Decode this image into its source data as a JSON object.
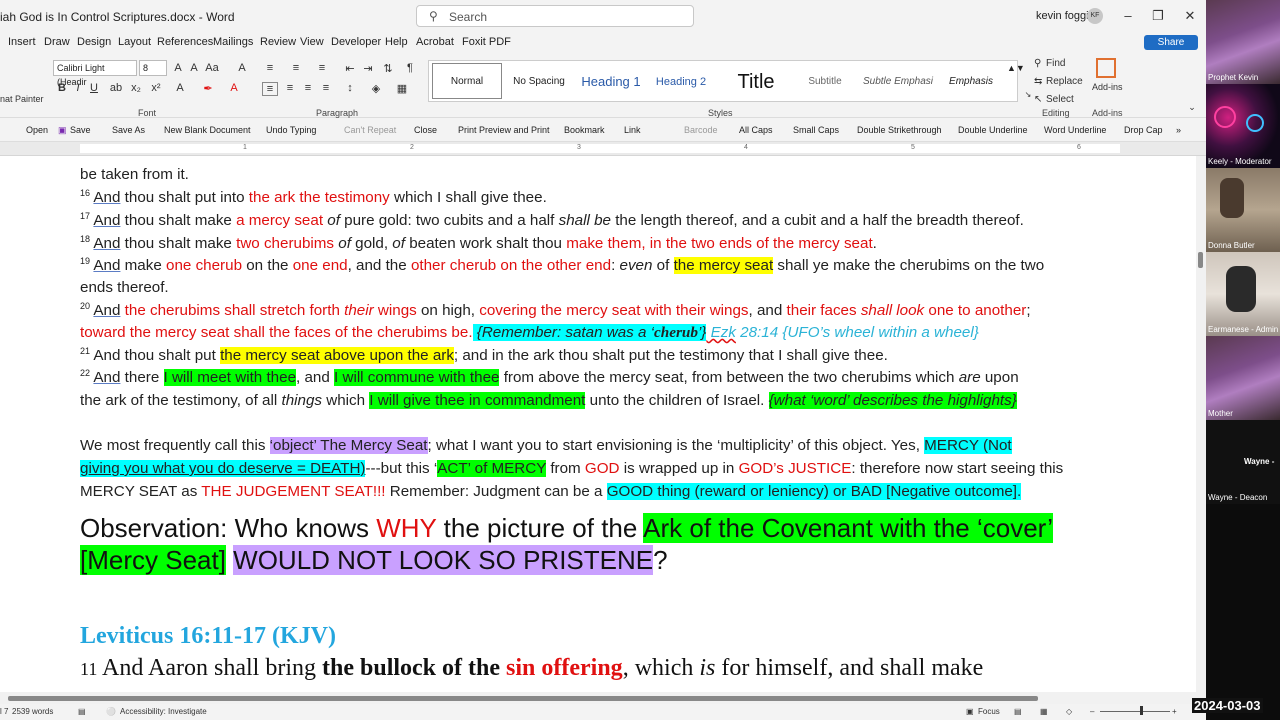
{
  "window": {
    "doc_title": "iah God is In Control Scriptures.docx  -  Word",
    "search_placeholder": "Search",
    "user_name": "kevin foggie",
    "user_initials": "KF",
    "share_label": "Share"
  },
  "menu": [
    "Insert",
    "Draw",
    "Design",
    "Layout",
    "References",
    "Mailings",
    "Review",
    "View",
    "Developer",
    "Help",
    "Acrobat",
    "Foxit PDF"
  ],
  "ribbon": {
    "format_painter": "nat Painter",
    "font_name": "Calibri Light (Headir",
    "font_size": "8",
    "group_font": "Font",
    "group_paragraph": "Paragraph",
    "group_styles": "Styles",
    "group_editing": "Editing",
    "group_addins": "Add-ins",
    "styles": [
      "Normal",
      "No Spacing",
      "Heading 1",
      "Heading 2",
      "Title",
      "Subtitle",
      "Subtle Emphasi",
      "Emphasis"
    ],
    "editing": [
      "Find",
      "Replace",
      "Select"
    ],
    "addins": "Add-ins"
  },
  "qat": [
    "Open",
    "Save",
    "Save As",
    "New Blank Document",
    "Undo Typing",
    "Can't Repeat",
    "Close",
    "Print Preview and Print",
    "Bookmark",
    "Link",
    "Barcode",
    "All Caps",
    "Small Caps",
    "Double Strikethrough",
    "Double Underline",
    "Word Underline",
    "Drop Cap"
  ],
  "ruler_numbers": [
    "1",
    "2",
    "3",
    "4",
    "5",
    "6"
  ],
  "doc": {
    "l0": "be taken from it.",
    "v16_num": "16",
    "v16_and": "And",
    "v16_a": " thou shalt put into ",
    "v16_b": "the ark the testimony",
    "v16_c": " which I shall give thee.",
    "v17_num": "17",
    "v17_and": "And",
    "v17_a": " thou shalt make ",
    "v17_b": "a mercy seat",
    "v17_c": " of",
    "v17_d": " pure gold: two cubits and a half ",
    "v17_e": "shall be",
    "v17_f": " the length thereof, and a cubit and a half the breadth thereof.",
    "v18_num": "18",
    "v18_and": "And",
    "v18_a": " thou shalt make ",
    "v18_b": "two cherubims",
    "v18_c": " of",
    "v18_d": " gold, ",
    "v18_e": "of",
    "v18_f": " beaten work shalt thou ",
    "v18_g": "make them, in the two ends of the mercy seat",
    "v18_h": ".",
    "v19_num": "19",
    "v19_and": "And",
    "v19_a": " make ",
    "v19_b": "one cherub",
    "v19_c": " on the ",
    "v19_d": "one end",
    "v19_e": ", and the ",
    "v19_f": "other cherub on the other end",
    "v19_g": ": ",
    "v19_h": "even",
    "v19_i": " of ",
    "v19_j": "the mercy seat",
    "v19_k": " shall ye make the cherubims on the two",
    "v19_l2": "ends thereof.",
    "v20_num": "20",
    "v20_and": "And",
    "v20_a": " the cherubims shall stretch forth ",
    "v20_b": "their",
    "v20_c": " wings",
    "v20_d": " on high, ",
    "v20_e": "covering the mercy seat with their wings",
    "v20_f": ", and ",
    "v20_g": "their faces ",
    "v20_h": "shall look",
    "v20_i": " one to another",
    "v20_j": ";",
    "v20_l2a": "toward the mercy seat shall the faces of the cherubims be.",
    "v20_l2b": " {Remember: satan was a ‘",
    "v20_l2c": "cherub",
    "v20_l2d": "’}",
    "v20_l2e": "  Ezk",
    "v20_l2f": " 28:14 {UFO’s wheel within a wheel}",
    "v21_num": "21",
    "v21_a": "And thou shalt put ",
    "v21_b": "the mercy seat above upon the ark",
    "v21_c": "; and in the ark thou shalt put the testimony that I shall give thee.",
    "v22_num": "22",
    "v22_and": "And",
    "v22_a": " there ",
    "v22_b": "I will meet with thee",
    "v22_c": ", and ",
    "v22_d": "I will commune with thee",
    "v22_e": " from above the mercy seat, from between the two cherubims which ",
    "v22_f": "are",
    "v22_g": " upon",
    "v22_l2a": "the ark of the testimony, of all ",
    "v22_l2b": "things",
    "v22_l2c": " which ",
    "v22_l2d": "I will give thee in commandment",
    "v22_l2e": " unto the children of Israel. ",
    "v22_l2f": "{what ‘word’ describes the highlights}",
    "p1_a": "We most frequently call this ",
    "p1_b": "‘object’ The Mercy Seat",
    "p1_c": "; what I want you to start envisioning is the ‘multiplicity’ of this object.  Yes, ",
    "p1_d": "MERCY (Not",
    "p2_a": "giving you what you do deserve = DEATH)",
    "p2_b": "---but this ‘",
    "p2_c": "ACT’ of MERCY",
    "p2_d": " from ",
    "p2_e": "GOD",
    "p2_f": " is wrapped up in ",
    "p2_g": "GOD’s JUSTICE",
    "p2_h": ": therefore now start seeing this",
    "p3_a": "MERCY SEAT",
    "p3_b": " as ",
    "p3_c": "THE JUDGEMENT SEAT!!!",
    "p3_d": "  Remember: Judgment can be a ",
    "p3_e": "GOOD",
    "p3_f": " thing (",
    "p3_g": "reward",
    "p3_h": " or ",
    "p3_i": "leniency",
    "p3_j": ") or BAD [",
    "p3_k": "Negative outcome",
    "p3_l": "].",
    "obs_a": "Observation: Who knows ",
    "obs_b": "WHY",
    "obs_c": " the picture of the ",
    "obs_d": "Ark of the Covenant with the ‘cover’",
    "obs2_a": "[Mercy Seat]",
    "obs2_b": " ",
    "obs2_c": "WOULD NOT LOOK SO PRISTENE",
    "obs2_d": "?",
    "lev_heading": "Leviticus 16:11-17 (KJV)",
    "v11_num": "11",
    "v11_a": " And Aaron shall bring ",
    "v11_b": "the bullock of the ",
    "v11_c": "sin offering",
    "v11_d": ", which ",
    "v11_e": "is",
    "v11_f": " for himself, and shall make"
  },
  "status": {
    "page": "l 7",
    "words": "2539 words",
    "accessibility": "Accessibility: Investigate",
    "focus": "Focus"
  },
  "participants": [
    "Prophet Kevin",
    "Keely - Moderator",
    "Donna Butler",
    "Earmanese - Admin",
    "Mother",
    "Wayne -",
    "Wayne - Deacon"
  ],
  "clock": "2024-03-03"
}
